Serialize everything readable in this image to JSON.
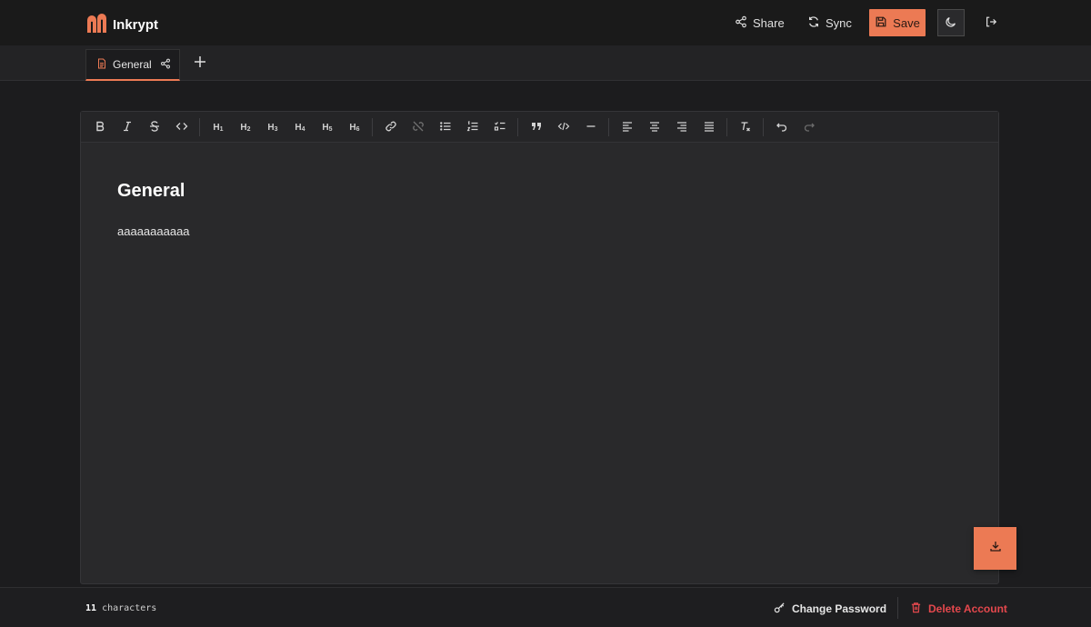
{
  "app": {
    "name": "Inkrypt"
  },
  "header": {
    "share_label": "Share",
    "sync_label": "Sync",
    "save_label": "Save",
    "icons": [
      "logo-icon",
      "share-icon",
      "sync-icon",
      "save-icon",
      "moon-icon",
      "logout-icon"
    ]
  },
  "tabs": [
    {
      "label": "General",
      "active": true
    }
  ],
  "toolbar": {
    "headings": [
      "H",
      "H",
      "H",
      "H",
      "H",
      "H"
    ],
    "heading_levels": [
      "1",
      "2",
      "3",
      "4",
      "5",
      "6"
    ],
    "tools": [
      "bold",
      "italic",
      "strikethrough",
      "code",
      "h1",
      "h2",
      "h3",
      "h4",
      "h5",
      "h6",
      "link",
      "unlink",
      "bullet-list",
      "ordered-list",
      "task-list",
      "blockquote",
      "code-block",
      "horizontal-rule",
      "align-left",
      "align-center",
      "align-right",
      "align-justify",
      "clear-format",
      "undo",
      "redo"
    ]
  },
  "document": {
    "title": "General",
    "body": "aaaaaaaaaaa"
  },
  "footer": {
    "char_count": "11",
    "char_label": "characters",
    "change_password_label": "Change Password",
    "delete_account_label": "Delete Account"
  },
  "colors": {
    "accent": "#ec7a54",
    "danger": "#e5484d",
    "background": "#1c1c1e",
    "editor": "#29292b"
  }
}
